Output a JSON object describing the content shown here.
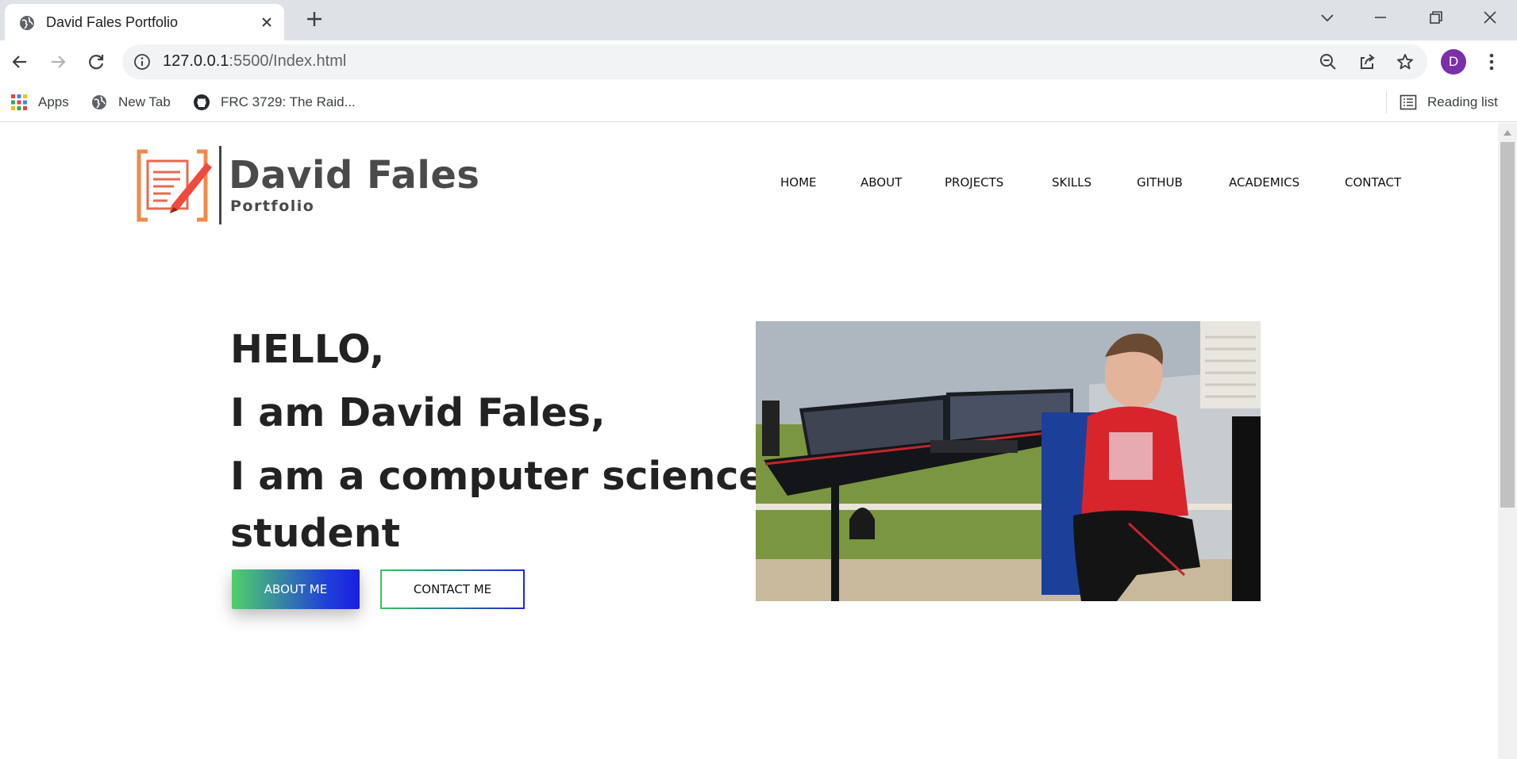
{
  "browser": {
    "tab": {
      "title": "David Fales Portfolio",
      "favicon": "globe-icon"
    },
    "url": {
      "host": "127.0.0.1",
      "path": ":5500/Index.html"
    },
    "profile_initial": "D",
    "bookmarks": [
      {
        "label": "Apps",
        "icon": "apps-grid-icon"
      },
      {
        "label": "New Tab",
        "icon": "globe-icon"
      },
      {
        "label": "FRC 3729: The Raid...",
        "icon": "github-icon"
      }
    ],
    "reading_list": "Reading list"
  },
  "site": {
    "logo": {
      "name": "David Fales",
      "subtitle": "Portfolio"
    },
    "nav": [
      "HOME",
      "ABOUT",
      "PROJECTS",
      "SKILLS",
      "GITHUB",
      "ACADEMICS",
      "CONTACT"
    ],
    "hero": {
      "lines": [
        "HELLO,",
        "I am David Fales,",
        "I am a computer science",
        "student"
      ],
      "primary_button": "ABOUT ME",
      "secondary_button": "CONTACT ME"
    }
  },
  "colors": {
    "accent_green": "#4fd06a",
    "accent_blue": "#1a1ee0",
    "logo_orange": "#f08a4b",
    "avatar_purple": "#7b2fa9"
  }
}
